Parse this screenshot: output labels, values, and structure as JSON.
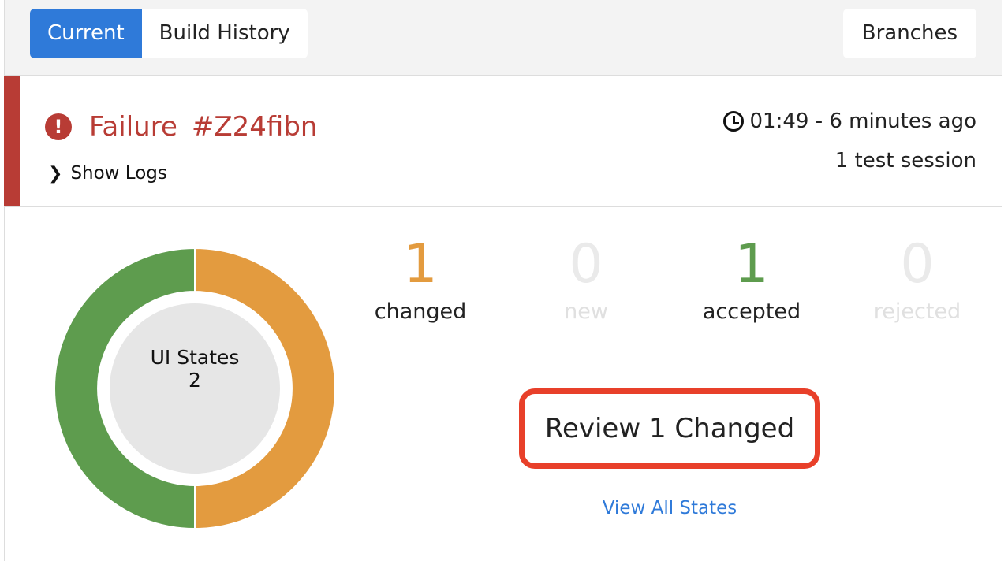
{
  "tabs": [
    {
      "label": "Current",
      "active": true
    },
    {
      "label": "Build History",
      "active": false
    }
  ],
  "branches_label": "Branches",
  "build": {
    "status": "Failure",
    "id": "#Z24fibn",
    "status_color": "#b83c35",
    "show_logs": "Show Logs",
    "time": "01:49 - 6 minutes ago",
    "sessions": "1 test session"
  },
  "stats": [
    {
      "value": "1",
      "label": "changed",
      "color": "#e39b3f"
    },
    {
      "value": "0",
      "label": "new",
      "color": "#e6e6e6"
    },
    {
      "value": "1",
      "label": "accepted",
      "color": "#5e9c4e"
    },
    {
      "value": "0",
      "label": "rejected",
      "color": "#e6e6e6"
    }
  ],
  "donut": {
    "title": "UI States",
    "total": "2",
    "segments": [
      {
        "label": "changed",
        "value": 1,
        "color": "#e39b3f"
      },
      {
        "label": "accepted",
        "value": 1,
        "color": "#5e9c4e"
      }
    ]
  },
  "review_button": "Review 1 Changed",
  "view_all": "View All States"
}
